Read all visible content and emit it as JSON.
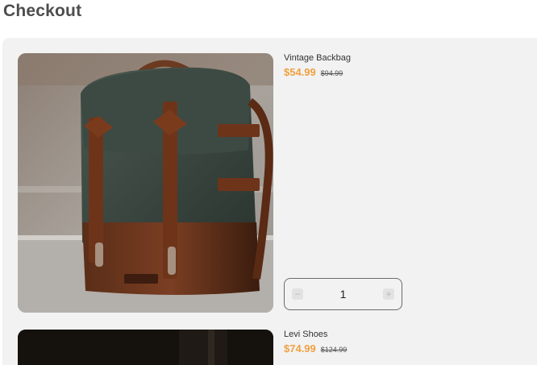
{
  "page": {
    "title": "Checkout"
  },
  "items": [
    {
      "name": "Vintage Backbag",
      "price": "$54.99",
      "old_price": "$94.99",
      "quantity": "1",
      "image_icon": "backpack-photo"
    },
    {
      "name": "Levi Shoes",
      "price": "$74.99",
      "old_price": "$124.99",
      "image_icon": "shoes-photo"
    }
  ],
  "quantity_controls": {
    "minus_symbol": "−",
    "plus_symbol": "+"
  },
  "colors": {
    "accent_price": "#f0a040",
    "panel_bg": "#f2f2f2",
    "title": "#4d4d4d"
  }
}
